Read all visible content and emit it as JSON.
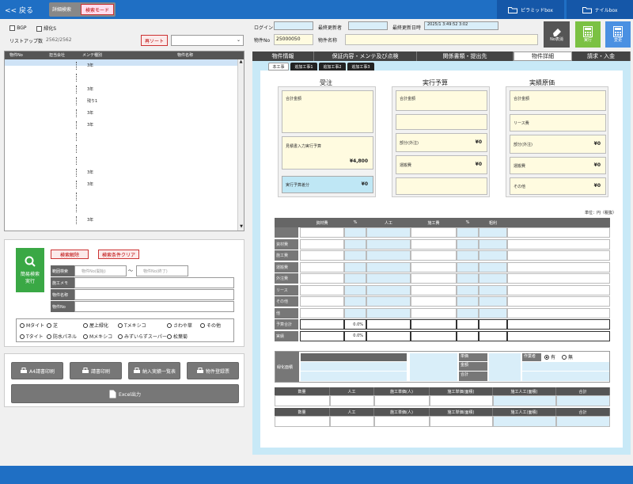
{
  "topbar": {
    "back": "<< 戻る",
    "detail_search": "詳細検索",
    "search_mode": "検索モード",
    "pyramid_box": "ピラミッドbox",
    "nile_box": "ナイルbox"
  },
  "left": {
    "bgp": "BGP",
    "ryokuka": "緑化S",
    "list_count_label": "リストアップ数",
    "list_count": "2562/2562",
    "resort": "再ソート",
    "list_headers": [
      "物件No",
      "担当会社",
      "メンテ種別",
      "物件名称"
    ],
    "list_rows": [
      "3年",
      "",
      "3年",
      "残り1",
      "3年",
      "3年",
      "",
      "",
      "",
      "3年",
      "3年",
      "",
      "",
      "3年"
    ],
    "search_btn": "簡易検索\n実行",
    "search_clear": "検索解除",
    "condition_clear": "検索条件クリア",
    "field_labels": [
      "範囲検索",
      "施工メモ",
      "物件名称",
      "物件No"
    ],
    "range_from_ph": "物件No(開始)",
    "range_to_ph": "物件No(終了)",
    "tilde": "〜",
    "radios_row1": [
      "Mタイト",
      "芝",
      "屋上緑化",
      "Tメキシコ",
      "さわや草",
      "その他"
    ],
    "radios_row2": [
      "Tタイト",
      "防水パネル",
      "Mメキシコ",
      "みずいらずスーパー",
      "松葉菊"
    ],
    "print_btns": [
      "A4請書印刷",
      "請書印刷",
      "納入実績一覧表",
      "物件登録票"
    ],
    "excel_btn": "Excel出力"
  },
  "right": {
    "login_label": "ログイン",
    "login_value": "",
    "update_user_label": "最終更新者",
    "update_user_value": "",
    "update_date_label": "最終更新日時",
    "update_date_value": "2025/1 3:49:52 3:02",
    "property_no_label": "物件No",
    "property_no_value": "25000050",
    "property_name_label": "物件名称",
    "no_display_btn": "No表消",
    "exec_btn": "実行",
    "change_btn": "変更",
    "tabs": [
      "物件情報",
      "保証内容・メンテ及び点検",
      "関係書類・提出先",
      "物件詳細",
      "請求・入金"
    ],
    "subtabs": [
      "本工事",
      "追加工事1",
      "追加工事2",
      "追加工事3"
    ],
    "sections": {
      "order": "受注",
      "budget": "実行予算",
      "actual": "実績原価"
    },
    "order_items": [
      "合計金額",
      "見積書入力実行予算",
      "実行予算差分"
    ],
    "order_values": [
      "",
      "¥4,800",
      "¥0"
    ],
    "budget_items": [
      "合計金額",
      "",
      "部分(外注)",
      "運搬費",
      ""
    ],
    "budget_values": [
      "",
      "",
      "¥0",
      "¥0",
      ""
    ],
    "actual_items": [
      "合計金額",
      "リース費",
      "部分(外注)",
      "運搬費",
      "その他"
    ],
    "actual_values": [
      "",
      "",
      "¥0",
      "¥0",
      "¥0"
    ],
    "unit_label": "単位：円（税抜）",
    "grid_headers": [
      "資材費",
      "%",
      "人工",
      "施工費",
      "%",
      "粗利"
    ],
    "grid_side": [
      "",
      "資材費",
      "施工費",
      "運搬費",
      "外注費",
      "リース",
      "その他",
      "他",
      "予算合計",
      "実績"
    ],
    "grid_totals1": [
      "",
      "0.0%",
      "",
      "",
      "",
      ""
    ],
    "grid_totals2": [
      "",
      "0.0%",
      "",
      "",
      "",
      ""
    ],
    "area_label": "緑化面積",
    "area_value": "",
    "rent_label": "作業者",
    "rent_yes": "有",
    "rent_no": "無",
    "calc_labels": [
      "単価",
      "金額",
      "合計"
    ],
    "bottom_hdr1": [
      "数量",
      "人工",
      "施工単価(人)",
      "施工単価(面積)",
      "施工人工(面積)",
      "合計"
    ],
    "bottom_hdr2": [
      "数量",
      "人工",
      "施工単価(人)",
      "施工単価(面積)",
      "施工人工(面積)",
      "合計"
    ]
  }
}
